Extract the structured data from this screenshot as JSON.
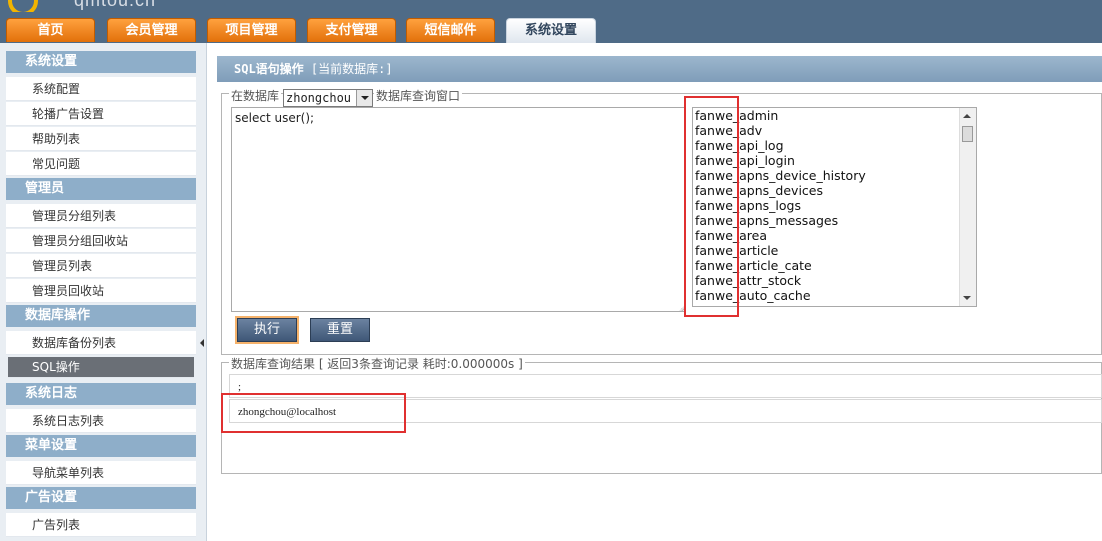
{
  "brand": {
    "logo_text": "qmtou.cn"
  },
  "nav_tabs": [
    {
      "label": "首页"
    },
    {
      "label": "会员管理"
    },
    {
      "label": "项目管理"
    },
    {
      "label": "支付管理"
    },
    {
      "label": "短信邮件"
    },
    {
      "label": "系统设置",
      "active": true
    }
  ],
  "sidebar": {
    "sections": [
      {
        "title": "系统设置",
        "items": [
          "系统配置",
          "轮播广告设置",
          "帮助列表",
          "常见问题"
        ]
      },
      {
        "title": "管理员",
        "items": [
          "管理员分组列表",
          "管理员分组回收站",
          "管理员列表",
          "管理员回收站"
        ]
      },
      {
        "title": "数据库操作",
        "items": [
          "数据库备份列表",
          "SQL操作"
        ]
      },
      {
        "title": "系统日志",
        "items": [
          "系统日志列表"
        ]
      },
      {
        "title": "菜单设置",
        "items": [
          "导航菜单列表"
        ]
      },
      {
        "title": "广告设置",
        "items": [
          "广告列表"
        ]
      }
    ],
    "active_item": "SQL操作"
  },
  "main": {
    "title": "SQL语句操作",
    "title_suffix": "[当前数据库:]",
    "query_panel": {
      "db_label": "在数据库",
      "db_selected": "zhongchou",
      "window_label": "数据库查询窗口",
      "sql_text": "select user();",
      "tables": [
        "fanwe_admin",
        "fanwe_adv",
        "fanwe_api_log",
        "fanwe_api_login",
        "fanwe_apns_device_history",
        "fanwe_apns_devices",
        "fanwe_apns_logs",
        "fanwe_apns_messages",
        "fanwe_area",
        "fanwe_article",
        "fanwe_article_cate",
        "fanwe_attr_stock",
        "fanwe_auto_cache"
      ],
      "execute_label": "执行",
      "reset_label": "重置"
    },
    "results": {
      "legend": "数据库查询结果 [ 返回3条查询记录 耗时:0.000000s ]",
      "rows": [
        ";",
        "zhongchou@localhost"
      ]
    }
  },
  "colors": {
    "topbar": "#4f6b87",
    "tab_orange": "#f08a1e",
    "section_header": "#8eaec9",
    "title_bar": "#8eaac4",
    "highlight_red": "#e03030"
  }
}
